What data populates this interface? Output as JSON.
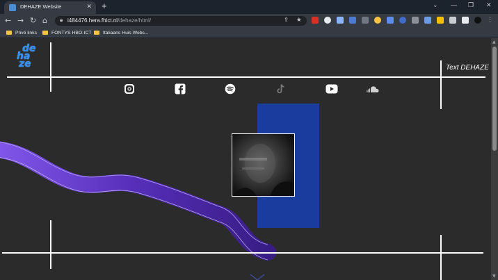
{
  "browser": {
    "tab": {
      "title": "DEHAZE Website",
      "close": "✕"
    },
    "new_tab": "+",
    "window_controls": {
      "collapse": "⌄",
      "minimize": "—",
      "restore": "❐",
      "close": "✕"
    },
    "nav": {
      "back": "←",
      "forward": "→",
      "reload": "↻",
      "home": "⌂"
    },
    "url": {
      "domain": "i484476.hera.fhict.nl",
      "path": "/dehaze/html/"
    },
    "bookmarks": [
      "Privé links",
      "FONTYS HBO-ICT",
      "Italiaans Huis Webs..."
    ]
  },
  "site": {
    "logo_lines": [
      "de",
      "ha",
      "ze"
    ],
    "corner_text": "Text DEHAZE",
    "social_icons": [
      "instagram-icon",
      "facebook-icon",
      "spotify-icon",
      "tiktok-icon",
      "youtube-icon",
      "soundcloud-icon"
    ],
    "colors": {
      "background": "#2b2b2b",
      "accent_blue": "#1a3c9e",
      "logo_blue": "#2e8fff",
      "wave_purple": "#6a3bd8"
    }
  }
}
